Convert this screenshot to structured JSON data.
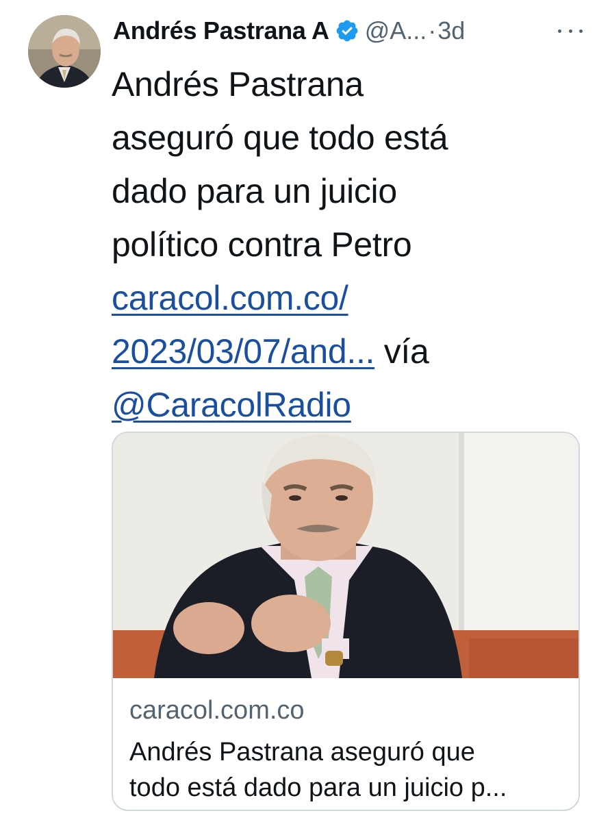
{
  "tweet": {
    "author": {
      "display_name": "Andrés Pastrana A",
      "handle": "@A...",
      "separator": "·",
      "time": "3d",
      "avatar_icon": "profile-photo",
      "verified_icon": "verified-badge-icon",
      "verified_color": "#1d9bf0"
    },
    "more_icon": "more-options-icon",
    "text_lines": [
      "Andrés Pastrana",
      "aseguró que todo está",
      "dado para un juicio",
      "político contra Petro"
    ],
    "link_line_1": "caracol.com.co/",
    "link_line_2": "2023/03/07/and...",
    "via_text": " vía",
    "mention": "@CaracolRadio",
    "link_color": "#1a4fa0"
  },
  "card": {
    "image_alt": "Andrés Pastrana photo",
    "domain": "caracol.com.co",
    "title_lines": [
      "Andrés Pastrana aseguró que",
      "todo está dado para un juicio p..."
    ]
  }
}
